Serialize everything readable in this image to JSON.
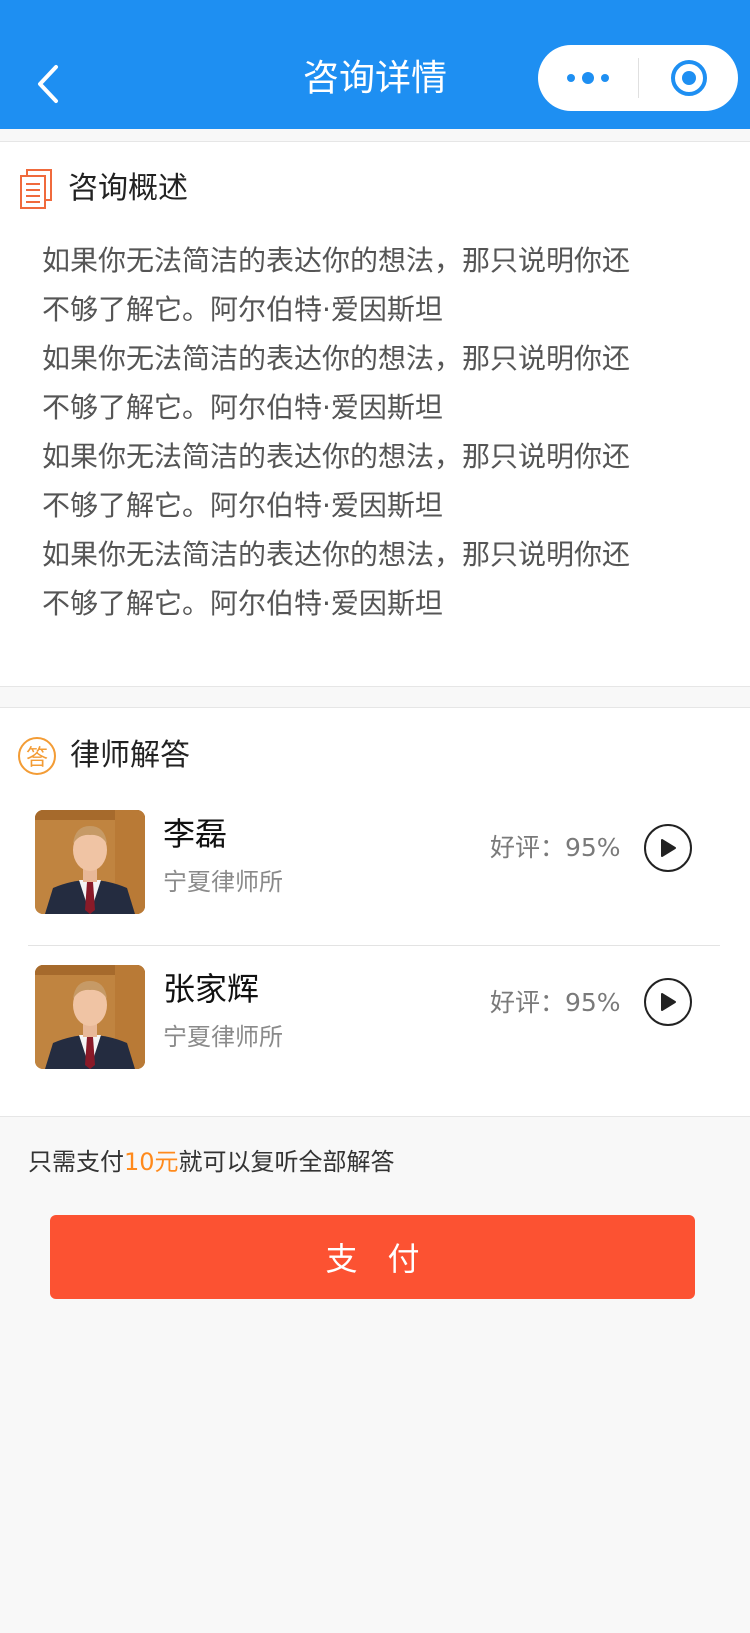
{
  "header": {
    "title": "咨询详情",
    "back_icon": "chevron-left-icon",
    "more_icon": "more-dots-icon",
    "target_icon": "target-icon"
  },
  "summary": {
    "title": "咨询概述",
    "icon": "document-icon",
    "lines": [
      "如果你无法简洁的表达你的想法，那只说明你还",
      "不够了解它。阿尔伯特·爱因斯坦",
      "如果你无法简洁的表达你的想法，那只说明你还",
      "不够了解它。阿尔伯特·爱因斯坦",
      "如果你无法简洁的表达你的想法，那只说明你还",
      "不够了解它。阿尔伯特·爱因斯坦",
      "如果你无法简洁的表达你的想法，那只说明你还",
      "不够了解它。阿尔伯特·爱因斯坦"
    ]
  },
  "answers": {
    "title": "律师解答",
    "badge": "答",
    "lawyers": [
      {
        "name": "李磊",
        "firm": "宁夏律师所",
        "rating": "好评：95%"
      },
      {
        "name": "张家辉",
        "firm": "宁夏律师所",
        "rating": "好评：95%"
      }
    ]
  },
  "pay": {
    "note_prefix": "只需支付",
    "note_amount": "10元",
    "note_suffix": "就可以复听全部解答",
    "button_label": "支付"
  },
  "colors": {
    "header_bg": "#1e8ff2",
    "accent_orange": "#f39c35",
    "pay_button": "#fc5232",
    "amount": "#ff8a1c"
  }
}
